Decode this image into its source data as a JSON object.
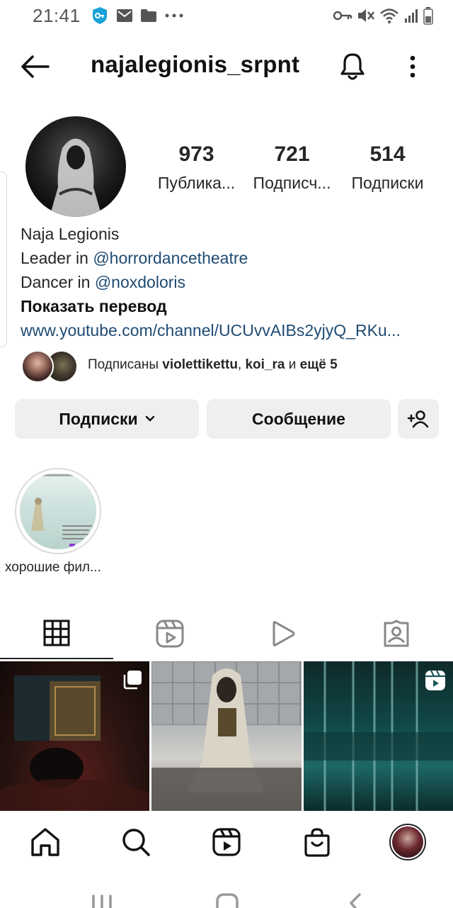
{
  "status_bar": {
    "time": "21:41",
    "left_icons": [
      "vpn-key-badge-icon",
      "mail-icon",
      "folder-icon",
      "more-dots-icon"
    ],
    "right_icons": [
      "key-icon",
      "mute-icon",
      "wifi-icon",
      "signal-icon",
      "battery-icon"
    ]
  },
  "header": {
    "username": "najalegionis_srpnt",
    "icons": [
      "back-arrow-icon",
      "bell-icon",
      "more-vertical-icon"
    ]
  },
  "profile": {
    "stats": [
      {
        "value": "973",
        "label": "Публика..."
      },
      {
        "value": "721",
        "label": "Подписч..."
      },
      {
        "value": "514",
        "label": "Подписки"
      }
    ],
    "name": "Naja Legionis",
    "bio_line1_prefix": "Leader in ",
    "bio_line1_mention": "@horrordancetheatre",
    "bio_line2_prefix": "Dancer in ",
    "bio_line2_mention": "@noxdoloris",
    "show_translation": "Показать перевод",
    "link": "www.youtube.com/channel/UCUvvAIBs2yjyQ_RKu..."
  },
  "followed_by": {
    "prefix": "Подписаны ",
    "user1": "violettikettu",
    "sep": ", ",
    "user2": "koi_ra",
    "mid": " и ",
    "more": "ещё 5"
  },
  "actions": {
    "following_label": "Подписки",
    "message_label": "Сообщение"
  },
  "highlight": {
    "title": "хорошие фил..."
  },
  "tabs": [
    "grid-icon",
    "reels-icon",
    "video-icon",
    "tagged-icon"
  ],
  "posts": [
    {
      "badge": "carousel-icon"
    },
    {
      "badge": ""
    },
    {
      "badge": "reel-icon"
    }
  ],
  "bottom_nav": [
    "home-icon",
    "search-icon",
    "reels-icon",
    "shop-icon",
    "profile-avatar"
  ],
  "colors": {
    "link": "#1f4b73",
    "button_bg": "#efefef",
    "text": "#262626"
  }
}
